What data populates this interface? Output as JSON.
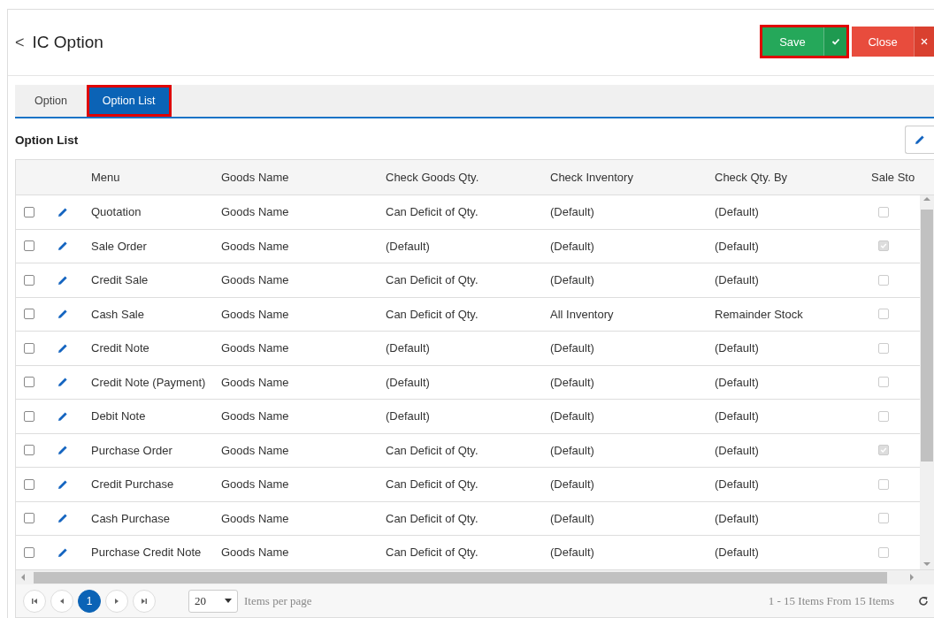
{
  "header": {
    "back": "<",
    "title": "IC Option",
    "buttons": [
      {
        "kind": "save",
        "label": "Save",
        "highlighted": true
      },
      {
        "kind": "close",
        "label": "Close",
        "highlighted": false
      }
    ]
  },
  "tabs": [
    {
      "label": "Option",
      "selected": false,
      "highlighted": false
    },
    {
      "label": "Option List",
      "selected": true,
      "highlighted": true
    }
  ],
  "section_title": "Option List",
  "table": {
    "columns": [
      "Menu",
      "Goods Name",
      "Check Goods Qty.",
      "Check Inventory",
      "Check Qty. By",
      "Sale Sto"
    ],
    "rows": [
      {
        "checked": false,
        "menu": "Quotation",
        "goods_name": "Goods Name",
        "check_goods_qty": "Can Deficit of Qty.",
        "check_inventory": "(Default)",
        "check_qty_by": "(Default)",
        "sale_stock": false
      },
      {
        "checked": false,
        "menu": "Sale Order",
        "goods_name": "Goods Name",
        "check_goods_qty": "(Default)",
        "check_inventory": "(Default)",
        "check_qty_by": "(Default)",
        "sale_stock": true
      },
      {
        "checked": false,
        "menu": "Credit Sale",
        "goods_name": "Goods Name",
        "check_goods_qty": "Can Deficit of Qty.",
        "check_inventory": "(Default)",
        "check_qty_by": "(Default)",
        "sale_stock": false
      },
      {
        "checked": false,
        "menu": "Cash Sale",
        "goods_name": "Goods Name",
        "check_goods_qty": "Can Deficit of Qty.",
        "check_inventory": "All Inventory",
        "check_qty_by": "Remainder Stock",
        "sale_stock": false
      },
      {
        "checked": false,
        "menu": "Credit Note",
        "goods_name": "Goods Name",
        "check_goods_qty": "(Default)",
        "check_inventory": "(Default)",
        "check_qty_by": "(Default)",
        "sale_stock": false
      },
      {
        "checked": false,
        "menu": "Credit Note (Payment)",
        "goods_name": "Goods Name",
        "check_goods_qty": "(Default)",
        "check_inventory": "(Default)",
        "check_qty_by": "(Default)",
        "sale_stock": false
      },
      {
        "checked": false,
        "menu": "Debit Note",
        "goods_name": "Goods Name",
        "check_goods_qty": "(Default)",
        "check_inventory": "(Default)",
        "check_qty_by": "(Default)",
        "sale_stock": false
      },
      {
        "checked": false,
        "menu": "Purchase Order",
        "goods_name": "Goods Name",
        "check_goods_qty": "Can Deficit of Qty.",
        "check_inventory": "(Default)",
        "check_qty_by": "(Default)",
        "sale_stock": true
      },
      {
        "checked": false,
        "menu": "Credit Purchase",
        "goods_name": "Goods Name",
        "check_goods_qty": "Can Deficit of Qty.",
        "check_inventory": "(Default)",
        "check_qty_by": "(Default)",
        "sale_stock": false
      },
      {
        "checked": false,
        "menu": "Cash Purchase",
        "goods_name": "Goods Name",
        "check_goods_qty": "Can Deficit of Qty.",
        "check_inventory": "(Default)",
        "check_qty_by": "(Default)",
        "sale_stock": false
      },
      {
        "checked": false,
        "menu": "Purchase Credit Note",
        "goods_name": "Goods Name",
        "check_goods_qty": "Can Deficit of Qty.",
        "check_inventory": "(Default)",
        "check_qty_by": "(Default)",
        "sale_stock": false
      }
    ]
  },
  "pager": {
    "pages": [
      {
        "label": "1",
        "selected": true
      }
    ],
    "page_size": "20",
    "page_size_label": "Items per page",
    "summary": "1 - 15 Items From 15 Items"
  }
}
